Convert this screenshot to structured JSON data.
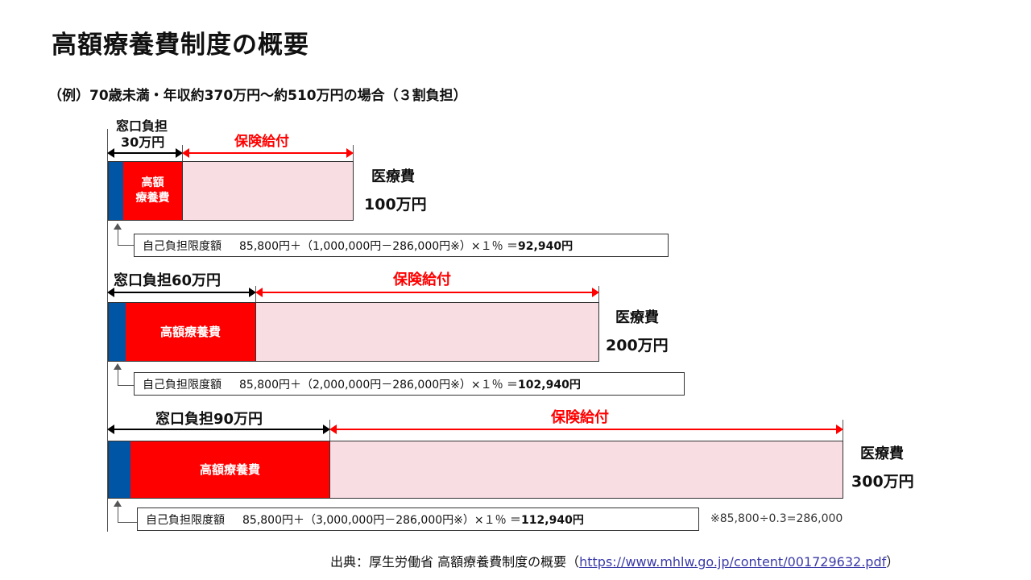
{
  "title": "高額療養費制度の概要",
  "subtitle": "（例）70歳未満・年収約370万円～約510万円の場合（３割負担）",
  "scenarios": [
    {
      "window_label_line1": "窓口負担",
      "window_label_line2": "30万円",
      "insurance_label": "保険給付",
      "high_cost_label_line1": "高額",
      "high_cost_label_line2": "療養費",
      "medical_cost_label": "医療費",
      "medical_cost_value": "100万円",
      "limit_label": "自己負担限度額",
      "formula": "85,800円＋（1,000,000円－286,000円※）×１％ ＝ ",
      "result": "92,940円"
    },
    {
      "window_label": "窓口負担60万円",
      "insurance_label": "保険給付",
      "high_cost_label": "高額療養費",
      "medical_cost_label": "医療費",
      "medical_cost_value": "200万円",
      "limit_label": "自己負担限度額",
      "formula": "85,800円＋（2,000,000円－286,000円※）×１％ ＝ ",
      "result": "102,940円"
    },
    {
      "window_label": "窓口負担90万円",
      "insurance_label": "保険給付",
      "high_cost_label": "高額療養費",
      "medical_cost_label": "医療費",
      "medical_cost_value": "300万円",
      "limit_label": "自己負担限度額",
      "formula": "85,800円＋（3,000,000円－286,000円※）×１％ ＝ ",
      "result": "112,940円"
    }
  ],
  "note": "※85,800÷0.3=286,000",
  "source_prefix": "出典：厚生労働省 高額療養費制度の概要（",
  "source_link": "https://www.mhlw.go.jp/content/001729632.pdf",
  "source_suffix": "）",
  "colors": {
    "self_pay": "#0055a5",
    "high_cost": "#ff0000",
    "insurance": "#f8dde3",
    "insurance_label": "#ff0000"
  }
}
